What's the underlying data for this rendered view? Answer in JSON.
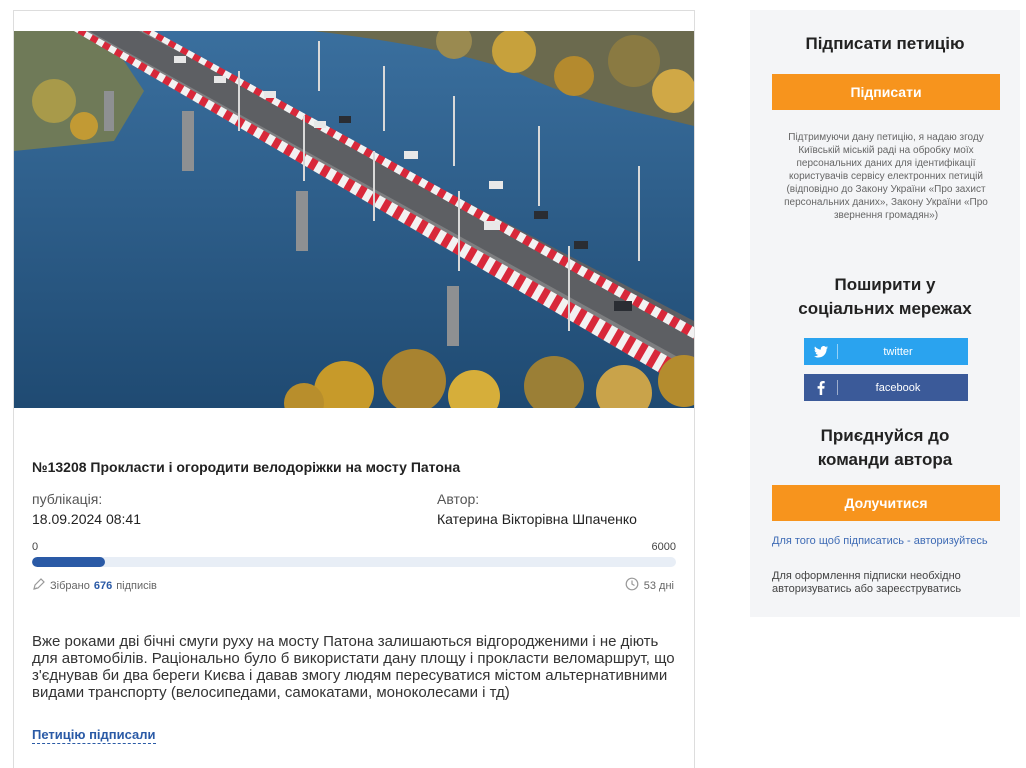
{
  "petition": {
    "title": "№13208 Прокласти і огородити велодоріжки на мосту Патона",
    "publication_label": "публікація:",
    "publication_date": "18.09.2024 08:41",
    "author_label": "Автор:",
    "author_name": "Катерина Вікторівна Шпаченко",
    "progress_min": "0",
    "progress_max": "6000",
    "signatures_collected": 676,
    "signatures_target": 6000,
    "collected_prefix": "Зібрано",
    "collected_count": "676",
    "collected_suffix": "підписів",
    "days_left": "53 дні",
    "description": "Вже роками дві бічні смуги руху на мосту Патона залишаються відгородженими і не діють для автомобілів. Раціонально було б використати дану площу і прокласти веломаршрут, що з'єднував би два береги Києва і давав змогу людям пересуватися містом альтернативними видами транспорту (велосипедами, самокатами, моноколесами і тд)",
    "signed_link": "Петицію підписали"
  },
  "sidebar": {
    "sign_title": "Підписати петицію",
    "sign_button": "Підписати",
    "consent_text": "Підтримуючи дану петицію, я надаю згоду Київській міській раді на обробку моїх персональних даних для ідентифікації користувачів сервісу електронних петицій (відповідно до Закону України «Про захист персональних даних», Закону України «Про звернення громадян»)",
    "share_title": "Поширити у соціальних мережах",
    "twitter_label": "twitter",
    "facebook_label": "facebook",
    "join_title": "Приєднуйся до команди автора",
    "join_button": "Долучитися",
    "auth_link": "Для того щоб підписатись - авторизуйтесь",
    "register_note": "Для оформлення підписки необхідно авторизуватись або зареєструватись"
  },
  "colors": {
    "accent_orange": "#f7941d",
    "progress_blue": "#2a5aa6",
    "twitter_blue": "#2aa3ef",
    "facebook_blue": "#3b5a99"
  }
}
